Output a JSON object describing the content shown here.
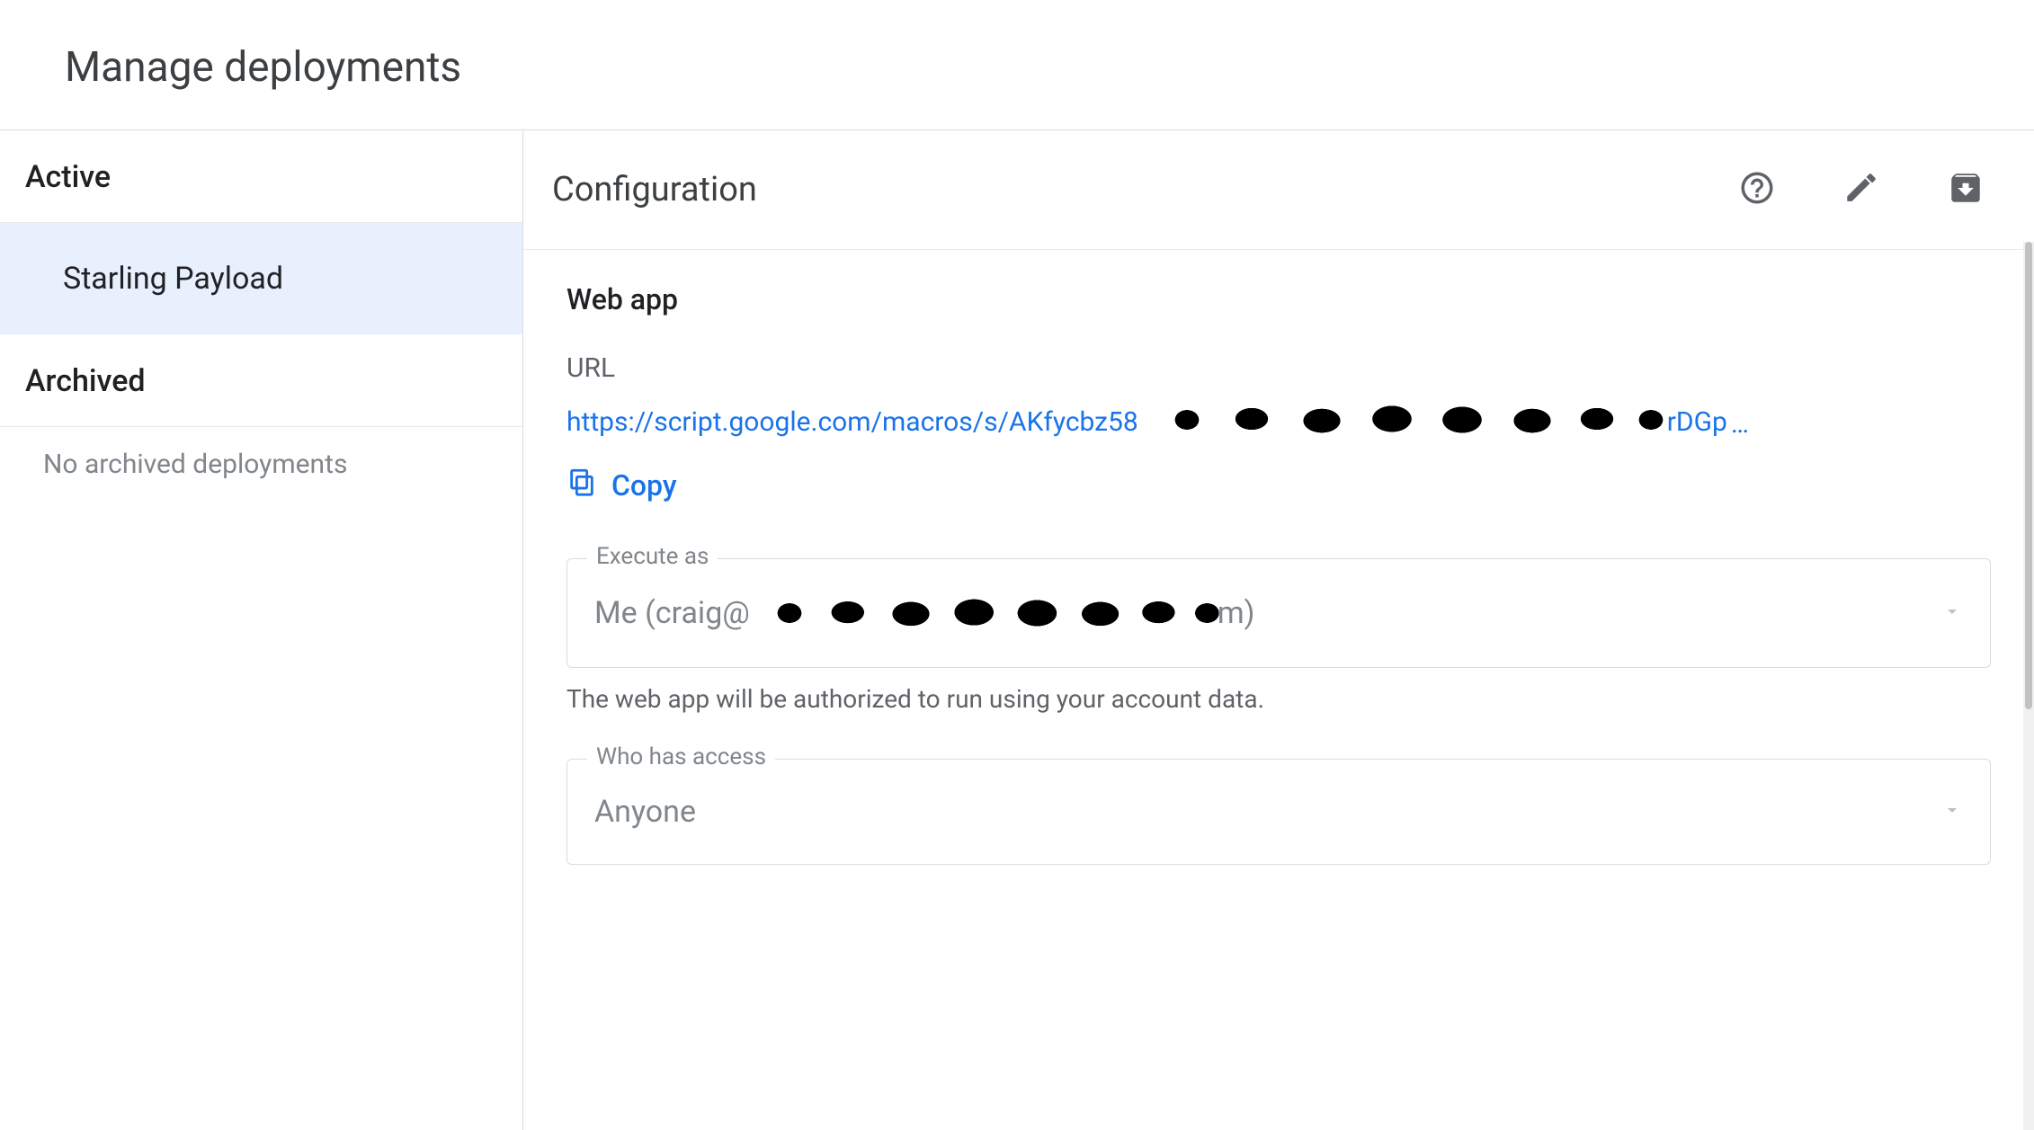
{
  "header": {
    "title": "Manage deployments"
  },
  "sidebar": {
    "active_label": "Active",
    "active_items": [
      {
        "label": "Starling Payload"
      }
    ],
    "archived_label": "Archived",
    "archived_empty": "No archived deployments"
  },
  "main": {
    "title": "Configuration",
    "web_app": {
      "title": "Web app",
      "url_label": "URL",
      "url_prefix": "https://script.google.com/macros/s/AKfycbz58",
      "url_suffix": "rDGp",
      "url_ellipsis": "…",
      "copy_label": "Copy"
    },
    "execute_as": {
      "label": "Execute as",
      "value_prefix": "Me (craig@",
      "value_suffix": "m)",
      "helper": "The web app will be authorized to run using your account data."
    },
    "who_has_access": {
      "label": "Who has access",
      "value": "Anyone"
    }
  }
}
